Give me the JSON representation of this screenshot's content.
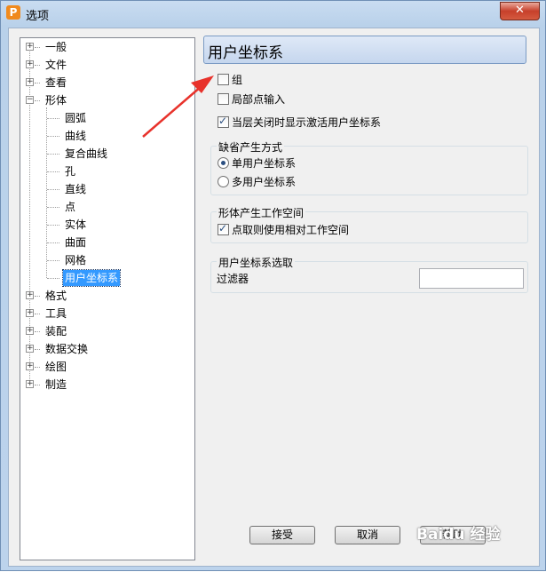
{
  "window": {
    "title": "选项",
    "app_icon_letter": "P",
    "close_symbol": "✕"
  },
  "tree": {
    "items": [
      {
        "label": "一般",
        "expander": "+"
      },
      {
        "label": "文件",
        "expander": "+"
      },
      {
        "label": "查看",
        "expander": "+"
      },
      {
        "label": "形体",
        "expander": "−"
      },
      {
        "label": "圆弧"
      },
      {
        "label": "曲线"
      },
      {
        "label": "复合曲线"
      },
      {
        "label": "孔"
      },
      {
        "label": "直线"
      },
      {
        "label": "点"
      },
      {
        "label": "实体"
      },
      {
        "label": "曲面"
      },
      {
        "label": "网格"
      },
      {
        "label": "用户坐标系",
        "selected": true
      },
      {
        "label": "格式",
        "expander": "+"
      },
      {
        "label": "工具",
        "expander": "+"
      },
      {
        "label": "装配",
        "expander": "+"
      },
      {
        "label": "数据交换",
        "expander": "+"
      },
      {
        "label": "绘图",
        "expander": "+"
      },
      {
        "label": "制造",
        "expander": "+"
      }
    ]
  },
  "panel": {
    "title": "用户坐标系",
    "checkbox_group": {
      "label": "组",
      "checked": false
    },
    "checkbox_local": {
      "label": "局部点输入",
      "checked": false
    },
    "checkbox_show_active": {
      "label": "当层关闭时显示激活用户坐标系",
      "checked": true
    },
    "default_mode": {
      "title": "缺省产生方式",
      "single": {
        "label": "单用户坐标系",
        "checked": true
      },
      "multi": {
        "label": "多用户坐标系",
        "checked": false
      }
    },
    "workspace": {
      "title": "形体产生工作空间",
      "relative": {
        "label": "点取则使用相对工作空间",
        "checked": true
      }
    },
    "ucs_pick": {
      "title": "用户坐标系选取",
      "filter_label": "过滤器",
      "filter_value": ""
    }
  },
  "buttons": {
    "accept": "接受",
    "cancel": "取消",
    "help": "帮助"
  },
  "watermark": "Baidu 经验",
  "colors": {
    "selection": "#3399ff",
    "arrow": "#e8322b",
    "title_bar": "#c9dcf1"
  }
}
